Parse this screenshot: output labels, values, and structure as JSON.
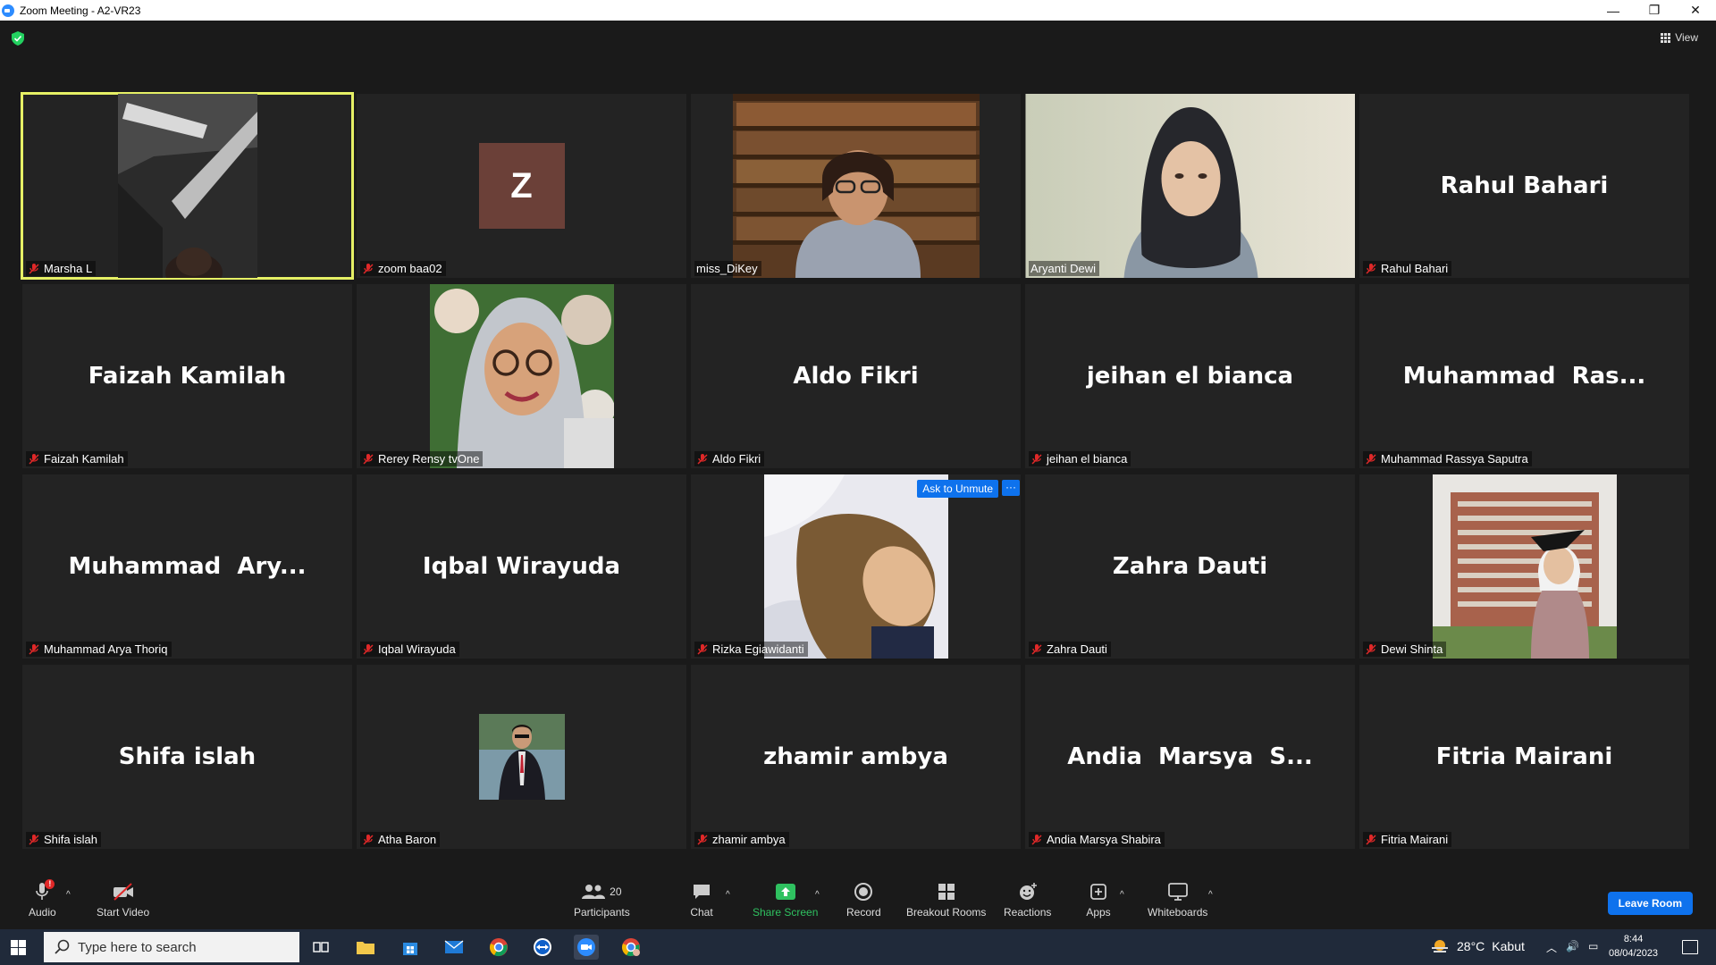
{
  "window": {
    "title": "Zoom Meeting - A2-VR23",
    "minimize": "—",
    "restore": "❐",
    "close": "✕"
  },
  "topbar": {
    "view_label": "View"
  },
  "participants": [
    {
      "tile_name": "Marsha L",
      "display": "video",
      "active": true
    },
    {
      "tile_name": "zoom baa02",
      "display": "avatar",
      "avatar_letter": "Z"
    },
    {
      "tile_name": "miss_DiKey",
      "display": "video"
    },
    {
      "tile_name": "Aryanti Dewi",
      "display": "video"
    },
    {
      "tile_name": "Rahul Bahari",
      "display": "name",
      "big_name": "Rahul Bahari"
    },
    {
      "tile_name": "Faizah Kamilah",
      "display": "name",
      "big_name": "Faizah Kamilah"
    },
    {
      "tile_name": "Rerey Rensy tvOne",
      "display": "video"
    },
    {
      "tile_name": "Aldo Fikri",
      "display": "name",
      "big_name": "Aldo Fikri"
    },
    {
      "tile_name": "jeihan el bianca",
      "display": "name",
      "big_name": "jeihan el bianca"
    },
    {
      "tile_name": "Muhammad Rassya Saputra",
      "display": "name",
      "big_name": "Muhammad  Ras..."
    },
    {
      "tile_name": "Muhammad Arya Thoriq",
      "display": "name",
      "big_name": "Muhammad  Ary..."
    },
    {
      "tile_name": "Iqbal Wirayuda",
      "display": "name",
      "big_name": "Iqbal Wirayuda"
    },
    {
      "tile_name": "Rizka Egiawidanti",
      "display": "video",
      "ask_to_unmute": "Ask to Unmute",
      "more": "···"
    },
    {
      "tile_name": "Zahra Dauti",
      "display": "name",
      "big_name": "Zahra Dauti"
    },
    {
      "tile_name": "Dewi Shinta",
      "display": "video"
    },
    {
      "tile_name": "Shifa islah",
      "display": "name",
      "big_name": "Shifa islah"
    },
    {
      "tile_name": "Atha Baron",
      "display": "photo"
    },
    {
      "tile_name": "zhamir ambya",
      "display": "name",
      "big_name": "zhamir ambya"
    },
    {
      "tile_name": "Andia Marsya Shabira",
      "display": "name",
      "big_name": "Andia  Marsya  S..."
    },
    {
      "tile_name": "Fitria Mairani",
      "display": "name",
      "big_name": "Fitria Mairani"
    }
  ],
  "controls": {
    "audio": "Audio",
    "start_video": "Start Video",
    "participants": "Participants",
    "participants_count": "20",
    "chat": "Chat",
    "share_screen": "Share Screen",
    "record": "Record",
    "breakout_rooms": "Breakout Rooms",
    "reactions": "Reactions",
    "apps": "Apps",
    "whiteboards": "Whiteboards",
    "leave_room": "Leave Room",
    "audio_badge": "!"
  },
  "taskbar": {
    "search_placeholder": "Type here to search",
    "weather_temp": "28°C",
    "weather_desc": "Kabut",
    "time": "8:44",
    "date": "08/04/2023"
  },
  "colors": {
    "active_speaker": "#e6f065",
    "accent_blue": "#0e72ed",
    "share_green": "#2fc160"
  }
}
